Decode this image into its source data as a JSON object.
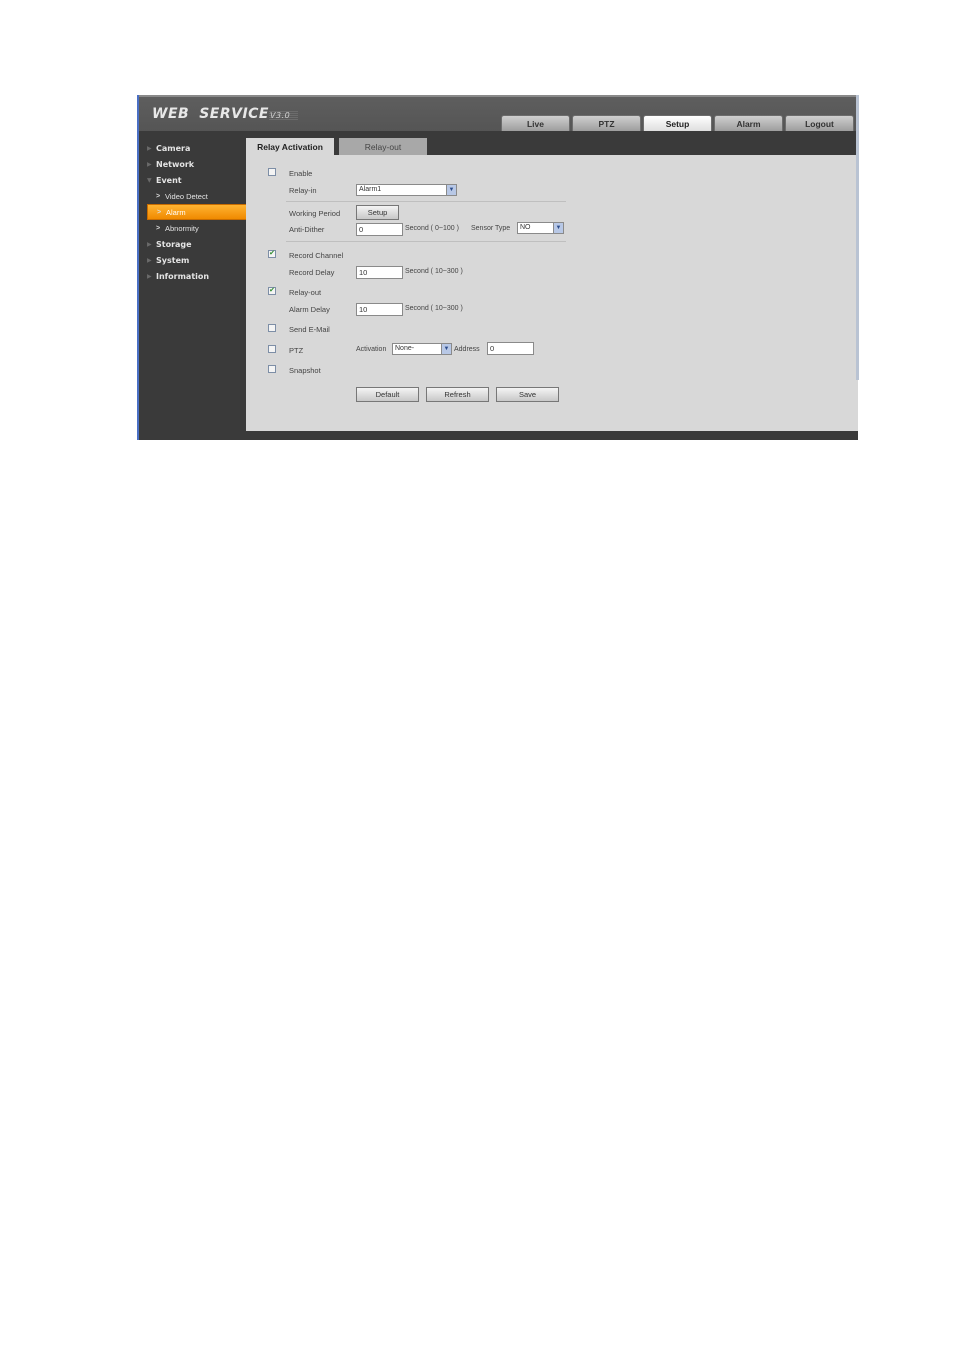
{
  "header": {
    "logo_main": "WEB",
    "logo_service": "SERVICE",
    "logo_version": "V3.0",
    "nav_tabs": [
      {
        "label": "Live",
        "active": false
      },
      {
        "label": "PTZ",
        "active": false
      },
      {
        "label": "Setup",
        "active": true
      },
      {
        "label": "Alarm",
        "active": false
      },
      {
        "label": "Logout",
        "active": false
      }
    ]
  },
  "sidebar": {
    "items": [
      {
        "label": "Camera",
        "expanded": false
      },
      {
        "label": "Network",
        "expanded": false
      },
      {
        "label": "Event",
        "expanded": true
      },
      {
        "label": "Storage",
        "expanded": false
      },
      {
        "label": "System",
        "expanded": false
      },
      {
        "label": "Information",
        "expanded": false
      }
    ],
    "event_children": [
      {
        "label": "Video Detect",
        "active": false
      },
      {
        "label": "Alarm",
        "active": true
      },
      {
        "label": "Abnormity",
        "active": false
      }
    ]
  },
  "content_tabs": [
    {
      "label": "Relay Activation",
      "active": true
    },
    {
      "label": "Relay-out",
      "active": false
    }
  ],
  "form": {
    "enable": {
      "label": "Enable",
      "checked": false
    },
    "relay_in": {
      "label": "Relay-in",
      "value": "Alarm1"
    },
    "working_period": {
      "label": "Working Period",
      "button": "Setup"
    },
    "anti_dither": {
      "label": "Anti-Dither",
      "value": "0",
      "unit": "Second ( 0~100 )"
    },
    "sensor_type": {
      "label": "Sensor Type",
      "value": "NO"
    },
    "record_channel": {
      "label": "Record Channel",
      "checked": true
    },
    "record_delay": {
      "label": "Record Delay",
      "value": "10",
      "unit": "Second ( 10~300 )"
    },
    "relay_out": {
      "label": "Relay-out",
      "checked": true
    },
    "alarm_delay": {
      "label": "Alarm Delay",
      "value": "10",
      "unit": "Second ( 10~300 )"
    },
    "send_email": {
      "label": "Send E-Mail",
      "checked": false
    },
    "ptz": {
      "label": "PTZ",
      "checked": false
    },
    "activation": {
      "label": "Activation",
      "value": "None-"
    },
    "address": {
      "label": "Address",
      "value": "0"
    },
    "snapshot": {
      "label": "Snapshot",
      "checked": false
    }
  },
  "buttons": {
    "default": "Default",
    "refresh": "Refresh",
    "save": "Save"
  },
  "icons": {
    "check": "✔",
    "arrow_down": "▼",
    "tri_right": "▶",
    "tri_down": "▼",
    "chevron": ">"
  }
}
